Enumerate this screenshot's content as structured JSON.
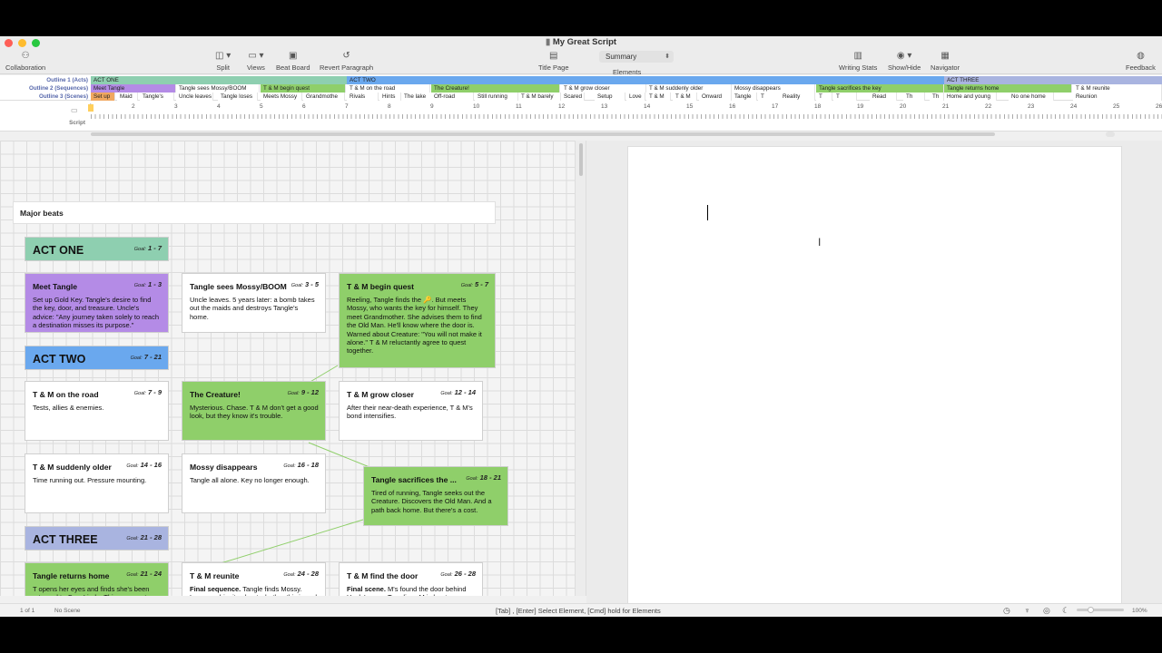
{
  "window": {
    "title": "My Great Script"
  },
  "toolbar": {
    "collaboration": "Collaboration",
    "split": "Split",
    "views": "Views",
    "beat_board": "Beat Board",
    "revert_paragraph": "Revert Paragraph",
    "title_page": "Title Page",
    "summary": "Summary",
    "elements": "Elements",
    "writing_stats": "Writing Stats",
    "show_hide": "Show/Hide",
    "navigator": "Navigator",
    "feedback": "Feedback"
  },
  "outline": {
    "labels": [
      "Outline 1 (Acts)",
      "Outline 2 (Sequences)",
      "Outline 3 (Scenes)"
    ],
    "acts": [
      {
        "label": "ACT ONE",
        "color": "#8ecfb0"
      },
      {
        "label": "ACT TWO",
        "color": "#6aa8ee"
      },
      {
        "label": "ACT THREE",
        "color": "#a9b4e0"
      }
    ],
    "sequences": [
      {
        "label": "Meet Tangle",
        "color": "#b48be6"
      },
      {
        "label": "Tangle sees Mossy/BOOM",
        "color": "#ffffff"
      },
      {
        "label": "T & M begin quest",
        "color": "#8fcf6a"
      },
      {
        "label": "T & M on the road",
        "color": "#ffffff"
      },
      {
        "label": "The Creature!",
        "color": "#8fcf6a"
      },
      {
        "label": "T & M grow closer",
        "color": "#ffffff"
      },
      {
        "label": "T & M suddenly older",
        "color": "#ffffff"
      },
      {
        "label": "Mossy disappears",
        "color": "#ffffff"
      },
      {
        "label": "Tangle sacrifices the key",
        "color": "#8fcf6a"
      },
      {
        "label": "Tangle returns home",
        "color": "#8fcf6a"
      },
      {
        "label": "T & M reunite",
        "color": "#ffffff"
      }
    ],
    "scenes": [
      {
        "label": "Set up",
        "color": "#f0a860"
      },
      {
        "label": "Maid",
        "color": "#ffffff"
      },
      {
        "label": "Tangle's",
        "color": "#ffffff"
      },
      {
        "label": "Uncle leaves",
        "color": "#ffffff"
      },
      {
        "label": "Tangle loses",
        "color": "#ffffff"
      },
      {
        "label": "Meets Mossy",
        "color": "#ffffff"
      },
      {
        "label": "Grandmothe",
        "color": "#ffffff"
      },
      {
        "label": "Rivals",
        "color": "#ffffff"
      },
      {
        "label": "Hints",
        "color": "#ffffff"
      },
      {
        "label": "The lake",
        "color": "#ffffff"
      },
      {
        "label": "Off-road",
        "color": "#ffffff"
      },
      {
        "label": "Still running",
        "color": "#ffffff"
      },
      {
        "label": "T & M barely",
        "color": "#ffffff"
      },
      {
        "label": "Scared",
        "color": "#ffffff"
      },
      {
        "label": "Setup",
        "color": "#ffffff"
      },
      {
        "label": "Love",
        "color": "#ffffff"
      },
      {
        "label": "T & M",
        "color": "#ffffff"
      },
      {
        "label": "T & M",
        "color": "#ffffff"
      },
      {
        "label": "Onward",
        "color": "#ffffff"
      },
      {
        "label": "Tangle",
        "color": "#ffffff"
      },
      {
        "label": "T",
        "color": "#ffffff"
      },
      {
        "label": "Reality",
        "color": "#ffffff"
      },
      {
        "label": "T",
        "color": "#ffffff"
      },
      {
        "label": "T",
        "color": "#ffffff"
      },
      {
        "label": "Read",
        "color": "#ffffff"
      },
      {
        "label": "Th",
        "color": "#ffffff"
      },
      {
        "label": "Th",
        "color": "#ffffff"
      },
      {
        "label": "Home and young",
        "color": "#ffffff"
      },
      {
        "label": "No one home",
        "color": "#ffffff"
      },
      {
        "label": "Reunion",
        "color": "#ffffff"
      }
    ],
    "script_label": "Script"
  },
  "ruler": {
    "numbers": [
      "1",
      "2",
      "3",
      "4",
      "5",
      "6",
      "7",
      "8",
      "9",
      "10",
      "11",
      "12",
      "13",
      "14",
      "15",
      "16",
      "17",
      "18",
      "19",
      "20",
      "21",
      "22",
      "23",
      "24",
      "25",
      "26"
    ]
  },
  "board": {
    "header": "Major beats",
    "cards": [
      {
        "title": "ACT ONE",
        "goal_label": "Goal:",
        "goal": "1 - 7",
        "body": "",
        "color": "#8ecfb0"
      },
      {
        "title": "Meet Tangle",
        "goal_label": "Goal:",
        "goal": "1 - 3",
        "body": "Set up Gold Key. Tangle's desire to find the key, door, and treasure. Uncle's advice: \"Any journey taken solely to reach a destination misses its purpose.\"",
        "color": "#b48be6"
      },
      {
        "title": "Tangle sees Mossy/BOOM",
        "goal_label": "Goal:",
        "goal": "3 - 5",
        "body": "Uncle leaves. 5 years later: a bomb takes out the maids and destroys Tangle's home.",
        "color": "#ffffff"
      },
      {
        "title": "T & M begin quest",
        "goal_label": "Goal:",
        "goal": "5 - 7",
        "body": "Reeling, Tangle finds the 🔑. But meets Mossy, who wants the key for himself. They meet Grandmother. She advises them to find the Old Man. He'll know where the door is. Warned about Creature: \"You will not make it alone.\" T & M reluctantly agree to quest together.",
        "color": "#8fcf6a"
      },
      {
        "title": "ACT TWO",
        "goal_label": "Goal:",
        "goal": "7 - 21",
        "body": "",
        "color": "#6aa8ee"
      },
      {
        "title": "T & M on the road",
        "goal_label": "Goal:",
        "goal": "7 - 9",
        "body": "Tests, allies & enemies.",
        "color": "#ffffff"
      },
      {
        "title": "The Creature!",
        "goal_label": "Goal:",
        "goal": "9 - 12",
        "body": "Mysterious. Chase. T & M don't get a good look, but they know it's trouble.",
        "color": "#8fcf6a"
      },
      {
        "title": "T & M grow closer",
        "goal_label": "Goal:",
        "goal": "12 - 14",
        "body": "After their near-death experience, T & M's bond intensifies.",
        "color": "#ffffff"
      },
      {
        "title": "T & M suddenly older",
        "goal_label": "Goal:",
        "goal": "14 - 16",
        "body": "Time running out. Pressure mounting.",
        "color": "#ffffff"
      },
      {
        "title": "Mossy disappears",
        "goal_label": "Goal:",
        "goal": "16 - 18",
        "body": "Tangle all alone. Key no longer enough.",
        "color": "#ffffff"
      },
      {
        "title": "Tangle sacrifices the ...",
        "goal_label": "Goal:",
        "goal": "18 - 21",
        "body": "Tired of running, Tangle seeks out the Creature. Discovers the Old Man. And a path back home. But there's a cost.",
        "color": "#8fcf6a"
      },
      {
        "title": "ACT THREE",
        "goal_label": "Goal:",
        "goal": "21 - 28",
        "body": "",
        "color": "#a9b4e0"
      },
      {
        "title": "Tangle returns home",
        "goal_label": "Goal:",
        "goal": "21 - 24",
        "body": "T opens her eyes and finds she's been returned to CasaLinda. Things seem to have reverted back to the way they were before she lost everything. But she's all alone there.",
        "color": "#8fcf6a"
      },
      {
        "title": "T & M reunite",
        "goal_label": "Goal:",
        "goal": "24 - 28",
        "body_bold": "Final sequence.",
        "body": " Tangle finds Mossy. Leave ambiguity about whether this is real or imagined (as if this was the Heaven T imagined when she took the leap of faith).",
        "color": "#ffffff"
      },
      {
        "title": "T & M find the door",
        "goal_label": "Goal:",
        "goal": "26 - 28",
        "body_bold": "Final scene.",
        "body": " M's found the door behind Uncle's map. T realizes M is her treasure. But they still turn the key.",
        "color": "#ffffff"
      }
    ]
  },
  "status": {
    "page": "1 of 1",
    "scene": "No Scene",
    "hint": "[Tab] , [Enter] Select Element, [Cmd] hold for Elements",
    "zoom": "100%"
  }
}
